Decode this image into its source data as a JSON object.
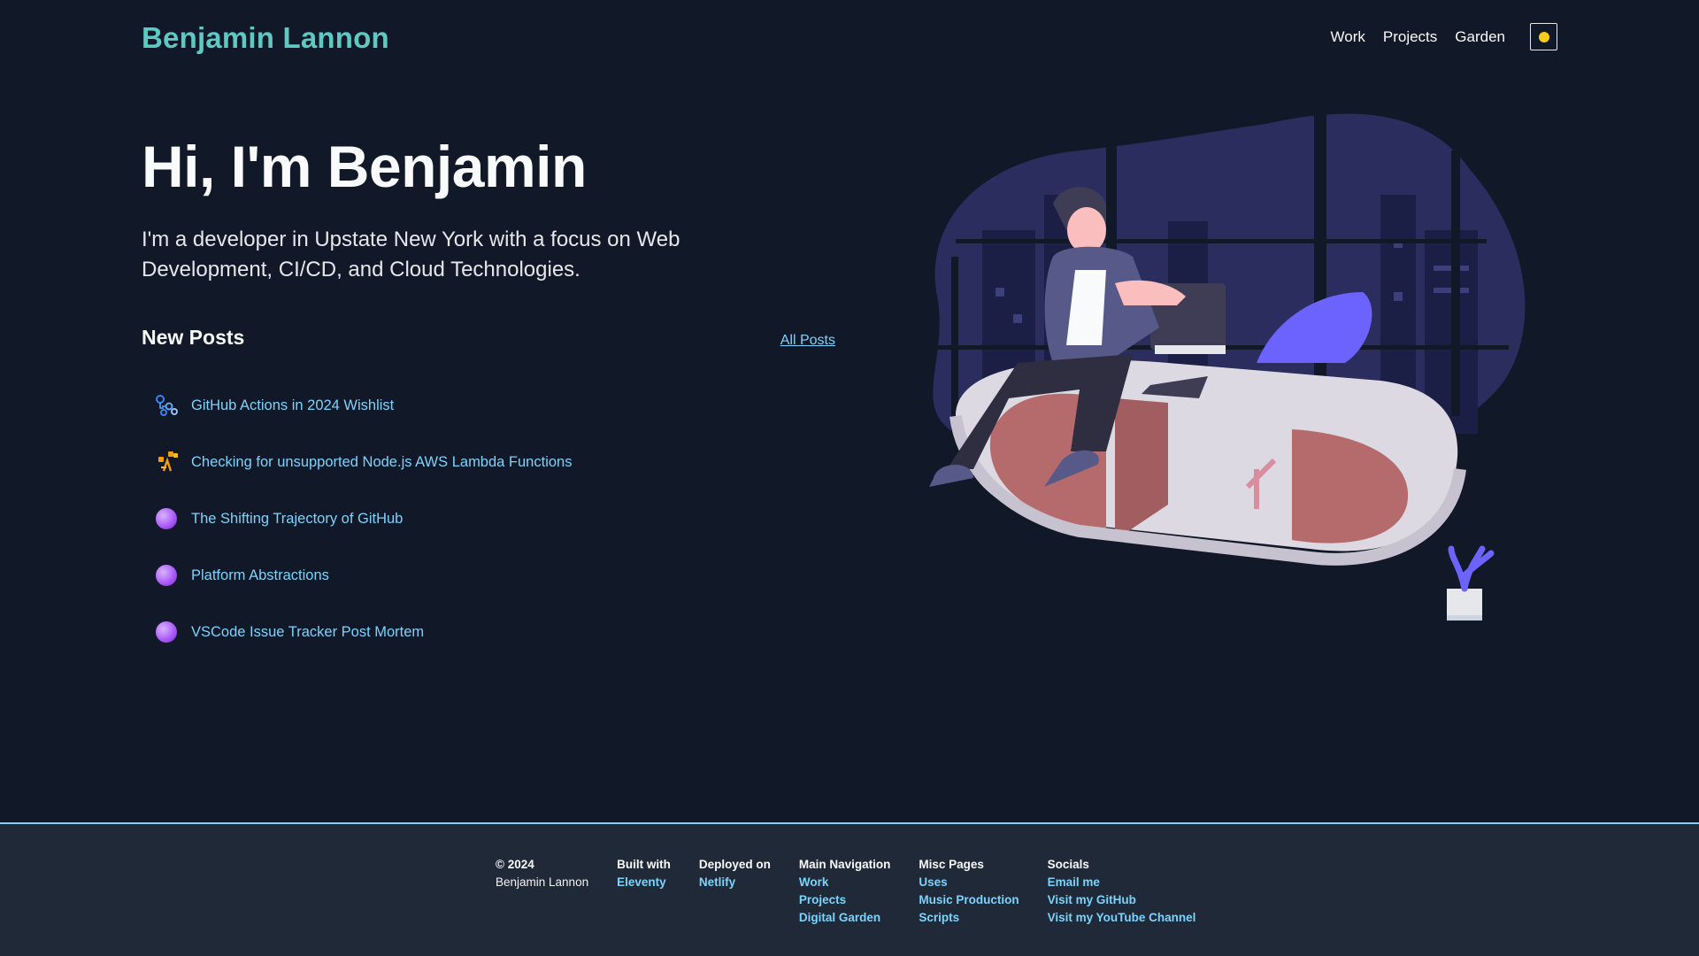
{
  "header": {
    "site_title": "Benjamin Lannon",
    "nav": [
      "Work",
      "Projects",
      "Garden"
    ]
  },
  "hero": {
    "heading": "Hi, I'm Benjamin",
    "intro": "I'm a developer in Upstate New York with a focus on Web Development, CI/CD, and Cloud Technologies."
  },
  "posts": {
    "title": "New Posts",
    "all_posts_label": "All Posts",
    "items": [
      {
        "title": "GitHub Actions in 2024 Wishlist",
        "icon": "github-actions-icon"
      },
      {
        "title": "Checking for unsupported Node.js AWS Lambda Functions",
        "icon": "aws-lambda-icon"
      },
      {
        "title": "The Shifting Trajectory of GitHub",
        "icon": "purple-bubble-icon"
      },
      {
        "title": "Platform Abstractions",
        "icon": "purple-bubble-icon"
      },
      {
        "title": "VSCode Issue Tracker Post Mortem",
        "icon": "purple-bubble-icon"
      }
    ]
  },
  "footer": {
    "copyright": {
      "title": "© 2024",
      "text": "Benjamin Lannon"
    },
    "built_with": {
      "title": "Built with",
      "link": "Eleventy"
    },
    "deployed_on": {
      "title": "Deployed on",
      "link": "Netlify"
    },
    "main_navigation": {
      "title": "Main Navigation",
      "links": [
        "Work",
        "Projects",
        "Digital Garden"
      ]
    },
    "misc_pages": {
      "title": "Misc Pages",
      "links": [
        "Uses",
        "Music Production",
        "Scripts"
      ]
    },
    "socials": {
      "title": "Socials",
      "links": [
        "Email me",
        "Visit my GitHub",
        "Visit my YouTube Channel"
      ]
    }
  },
  "colors": {
    "background": "#111827",
    "accent_teal": "#5ec8c3",
    "link_blue": "#7dd3fc",
    "footer_bg": "#1f2937",
    "sun_yellow": "#facc15",
    "purple": "#a855f7"
  }
}
